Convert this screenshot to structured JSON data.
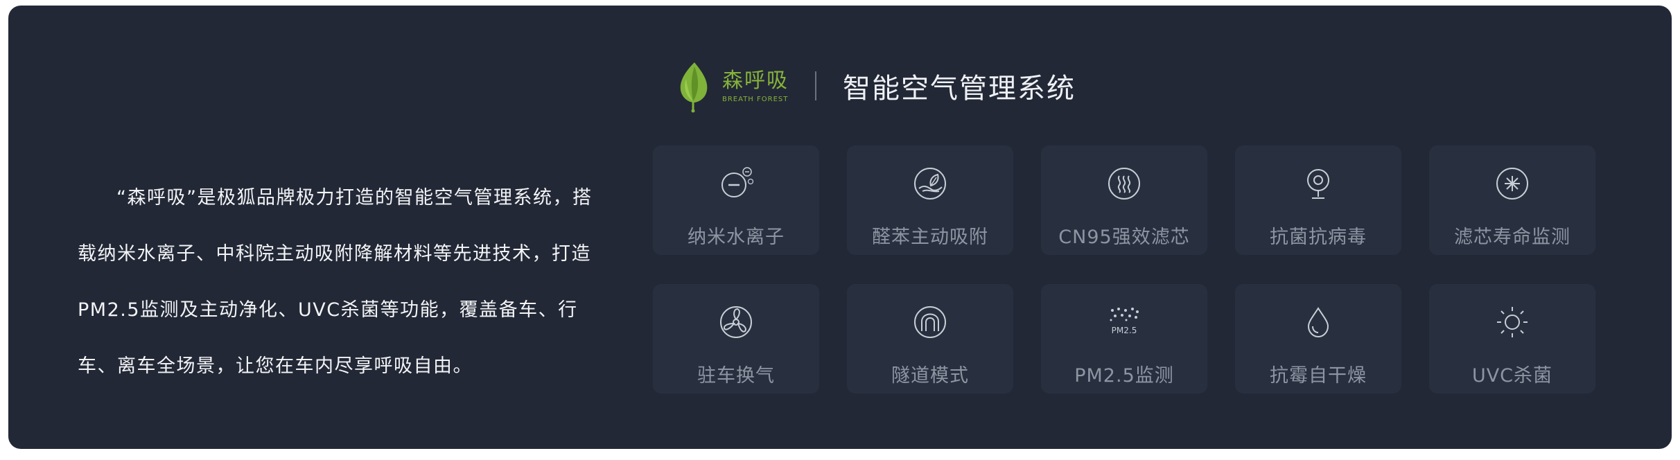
{
  "header": {
    "brand_name_cn": "森呼吸",
    "brand_name_en": "BREATH FOREST",
    "title": "智能空气管理系统"
  },
  "description": "“森呼吸”是极狐品牌极力打造的智能空气管理系统，搭载纳米水离子、中科院主动吸附降解材料等先进技术，打造PM2.5监测及主动净化、UVC杀菌等功能，覆盖备车、行车、离车全场景，让您在车内尽享呼吸自由。",
  "features": [
    {
      "label": "纳米水离子",
      "icon": "nano-ion-icon"
    },
    {
      "label": "醛苯主动吸附",
      "icon": "leaf-adsorb-icon"
    },
    {
      "label": "CN95强效滤芯",
      "icon": "filter-waves-icon"
    },
    {
      "label": "抗菌抗病毒",
      "icon": "antibacterial-icon"
    },
    {
      "label": "滤芯寿命监测",
      "icon": "filter-life-icon"
    },
    {
      "label": "驻车换气",
      "icon": "fan-icon"
    },
    {
      "label": "隧道模式",
      "icon": "tunnel-icon"
    },
    {
      "label": "PM2.5监测",
      "icon": "pm25-icon",
      "icon_text": "PM2.5"
    },
    {
      "label": "抗霉自干燥",
      "icon": "water-drop-icon"
    },
    {
      "label": "UVC杀菌",
      "icon": "sun-uvc-icon"
    }
  ],
  "colors": {
    "panel_bg": "#222836",
    "card_bg": "#283040",
    "brand_green": "#86b23a",
    "icon_color": "#c9ced6",
    "label_color": "#8e95a2"
  }
}
